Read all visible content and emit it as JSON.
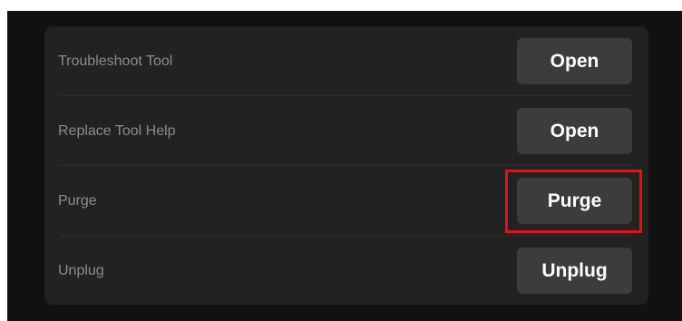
{
  "settings": {
    "rows": [
      {
        "label": "Troubleshoot Tool",
        "button_label": "Open"
      },
      {
        "label": "Replace Tool Help",
        "button_label": "Open"
      },
      {
        "label": "Purge",
        "button_label": "Purge"
      },
      {
        "label": "Unplug",
        "button_label": "Unplug"
      }
    ]
  },
  "colors": {
    "panel_background": "#111111",
    "card_background": "#222222",
    "button_background": "#3c3c3c",
    "label_text": "#8c8c8c",
    "button_text": "#ffffff",
    "highlight": "#e01414"
  }
}
